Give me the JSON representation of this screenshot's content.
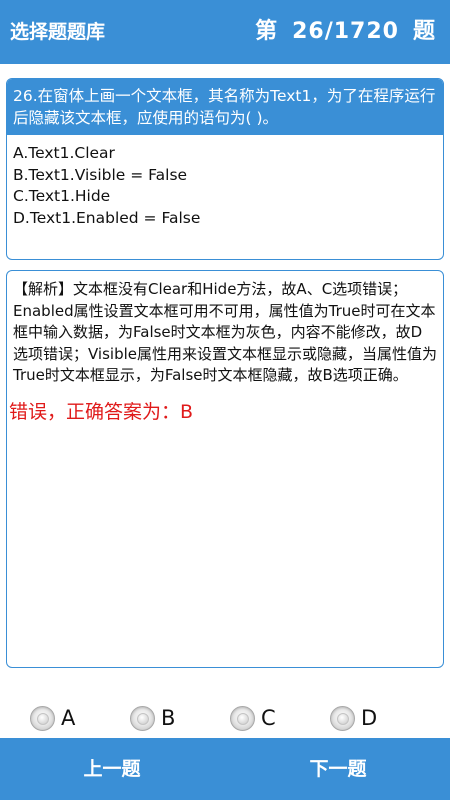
{
  "header": {
    "title": "选择题题库",
    "counter_prefix": "第",
    "counter_value": "26/1720",
    "counter_suffix": "题"
  },
  "question": {
    "stem": "26.在窗体上画一个文本框，其名称为Text1，为了在程序运行后隐藏该文本框，应使用的语句为( )。",
    "options": [
      "A.Text1.Clear",
      "B.Text1.Visible = False",
      "C.Text1.Hide",
      "D.Text1.Enabled = False"
    ]
  },
  "analysis": {
    "text": "【解析】文本框没有Clear和Hide方法，故A、C选项错误；Enabled属性设置文本框可用不可用，属性值为True时可在文本框中输入数据，为False时文本框为灰色，内容不能修改，故D选项错误；Visible属性用来设置文本框显示或隐藏，当属性值为True时文本框显示，为False时文本框隐藏，故B选项正确。",
    "result": "错误，正确答案为：B"
  },
  "choices": [
    "A",
    "B",
    "C",
    "D"
  ],
  "nav": {
    "prev": "上一题",
    "next": "下一题"
  }
}
